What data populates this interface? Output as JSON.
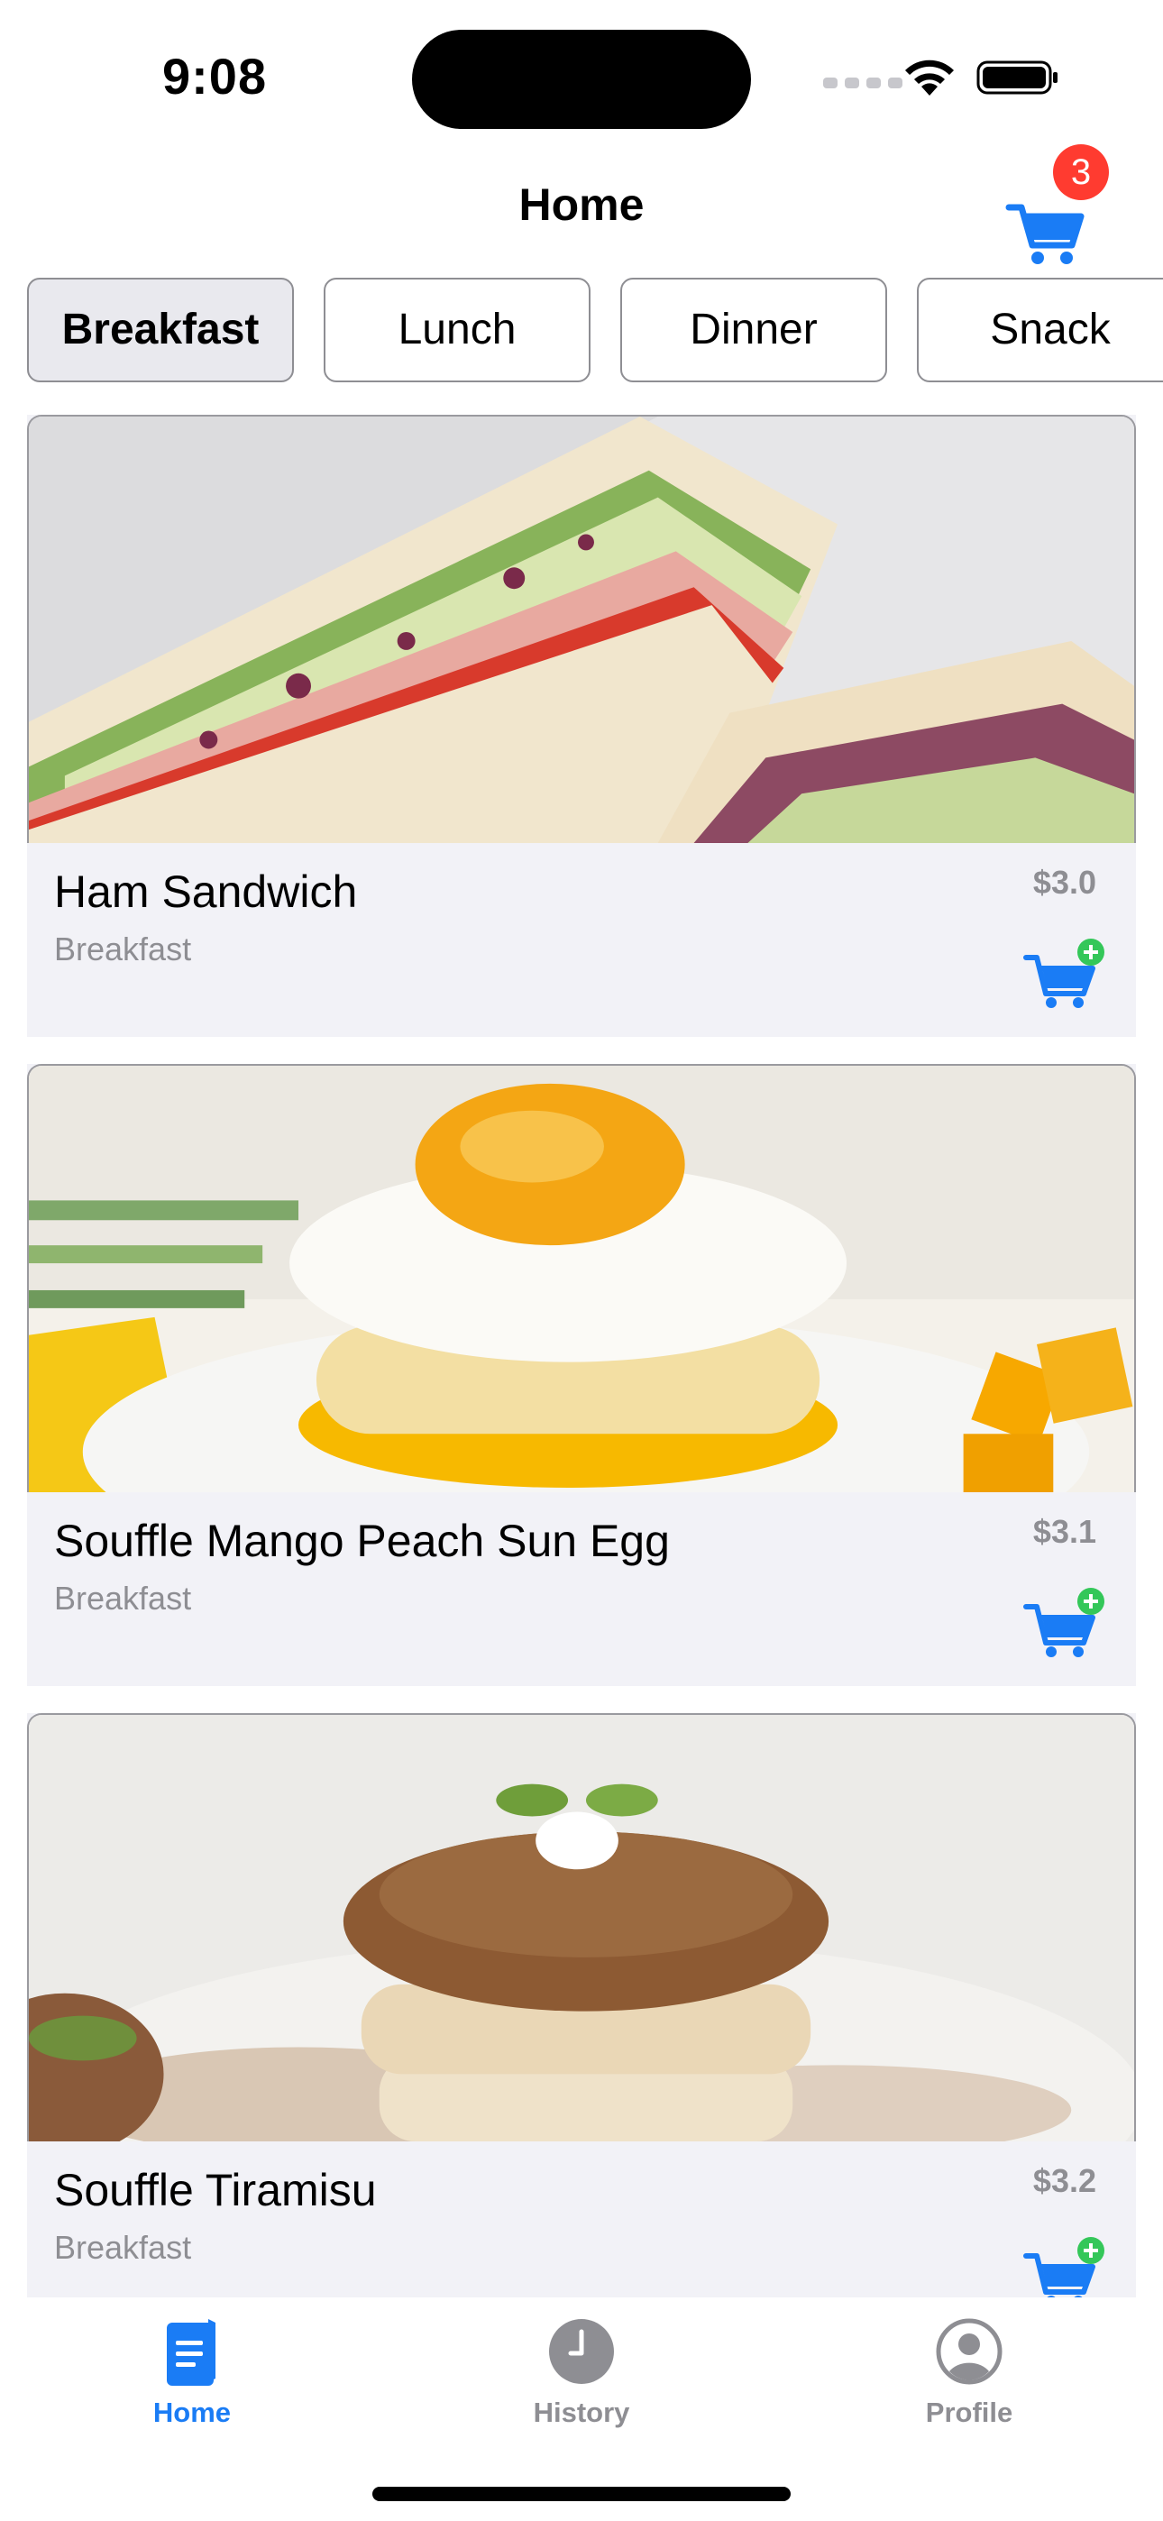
{
  "status_bar": {
    "time": "9:08"
  },
  "header": {
    "title": "Home",
    "cart_count": "3"
  },
  "categories": [
    {
      "label": "Breakfast",
      "active": true
    },
    {
      "label": "Lunch",
      "active": false
    },
    {
      "label": "Dinner",
      "active": false
    },
    {
      "label": "Snack",
      "active": false
    }
  ],
  "foods": [
    {
      "name": "Ham Sandwich",
      "category": "Breakfast",
      "price": "$3.0"
    },
    {
      "name": "Souffle Mango Peach Sun Egg",
      "category": "Breakfast",
      "price": "$3.1"
    },
    {
      "name": "Souffle Tiramisu",
      "category": "Breakfast",
      "price": "$3.2"
    }
  ],
  "tabs": [
    {
      "label": "Home",
      "icon": "book-icon",
      "active": true
    },
    {
      "label": "History",
      "icon": "clock-icon",
      "active": false
    },
    {
      "label": "Profile",
      "icon": "person-circle-icon",
      "active": false
    }
  ],
  "colors": {
    "accent": "#1a7cf5",
    "badge": "#ff3b30",
    "add": "#34c759",
    "inactive": "#8e8e93"
  }
}
